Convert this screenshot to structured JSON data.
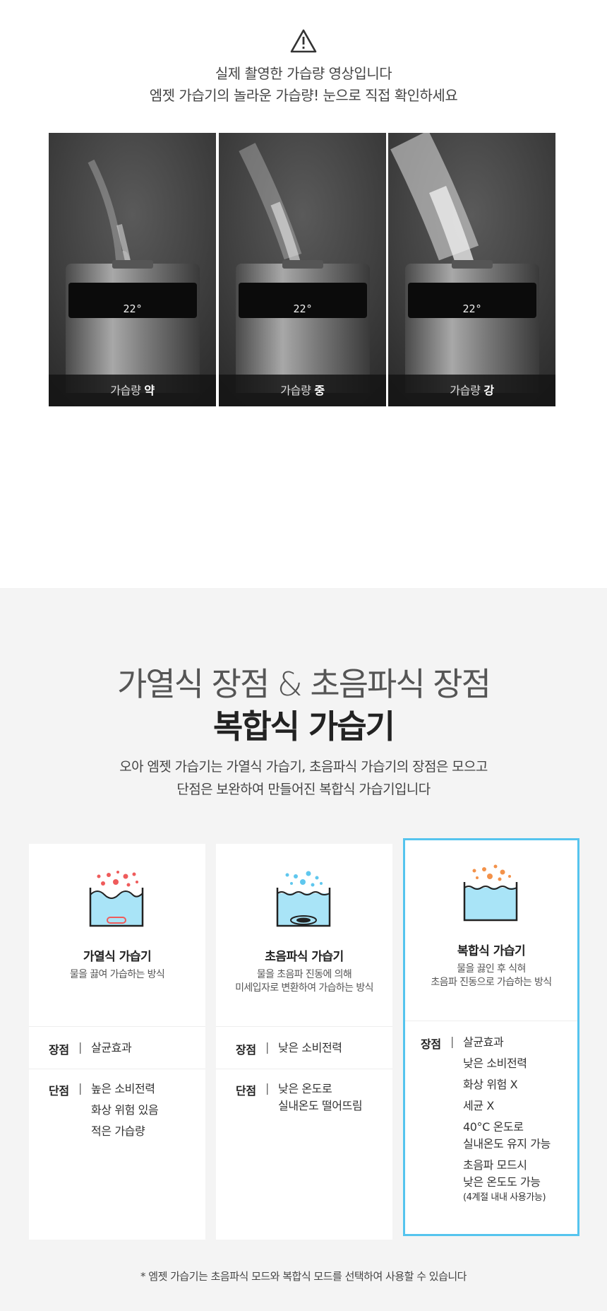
{
  "top": {
    "warning_icon": "warning-triangle-icon",
    "line1": "실제 촬영한 가습량 영상입니다",
    "line2": "엠젯 가습기의 놀라운 가습량! 눈으로 직접 확인하세요",
    "panels": [
      {
        "caption_prefix": "가습량",
        "caption_level": "약",
        "display": "22°"
      },
      {
        "caption_prefix": "가습량",
        "caption_level": "중",
        "display": "22°"
      },
      {
        "caption_prefix": "가습량",
        "caption_level": "강",
        "display": "22°"
      }
    ]
  },
  "bottom": {
    "headline1": "가열식 장점 & 초음파식 장점",
    "headline2": "복합식 가습기",
    "sub1": "오아 엠젯 가습기는 가열식 가습기, 초음파식 가습기의 장점은 모으고",
    "sub2": "단점은 보완하여 만들어진 복합식 가습기입니다",
    "cards": [
      {
        "title": "가열식 가습기",
        "desc1": "물을 끓여 가습하는 방식",
        "desc2": "",
        "pros_label": "장점",
        "pros": [
          "살균효과"
        ],
        "cons_label": "단점",
        "cons": [
          "높은 소비전력",
          "화상 위험 있음",
          "적은 가습량"
        ],
        "bubble_color": "#ef5b5b"
      },
      {
        "title": "초음파식 가습기",
        "desc1": "물을 초음파 진동에 의해",
        "desc2": "미세입자로 변환하여 가습하는 방식",
        "pros_label": "장점",
        "pros": [
          "낮은 소비전력"
        ],
        "cons_label": "단점",
        "cons": [
          "낮은 온도로",
          "실내온도 떨어뜨림"
        ],
        "bubble_color": "#5fc7ee"
      },
      {
        "title": "복합식 가습기",
        "desc1": "물을 끓인 후 식혀",
        "desc2": "초음파 진동으로 가습하는 방식",
        "pros_label": "장점",
        "pros": [
          "살균효과",
          "낮은 소비전력",
          "화상 위험 X",
          "세균 X",
          "40°C 온도로",
          "실내온도 유지 가능",
          "초음파 모드시",
          "낮은 온도도 가능",
          "(4계절 내내 사용가능)"
        ],
        "bubble_color": "#f3924a",
        "highlight_color": "#55c4ee"
      }
    ],
    "footnote": "* 엠젯 가습기는 초음파식 모드와 복합식 모드를 선택하여 사용할 수 있습니다"
  }
}
